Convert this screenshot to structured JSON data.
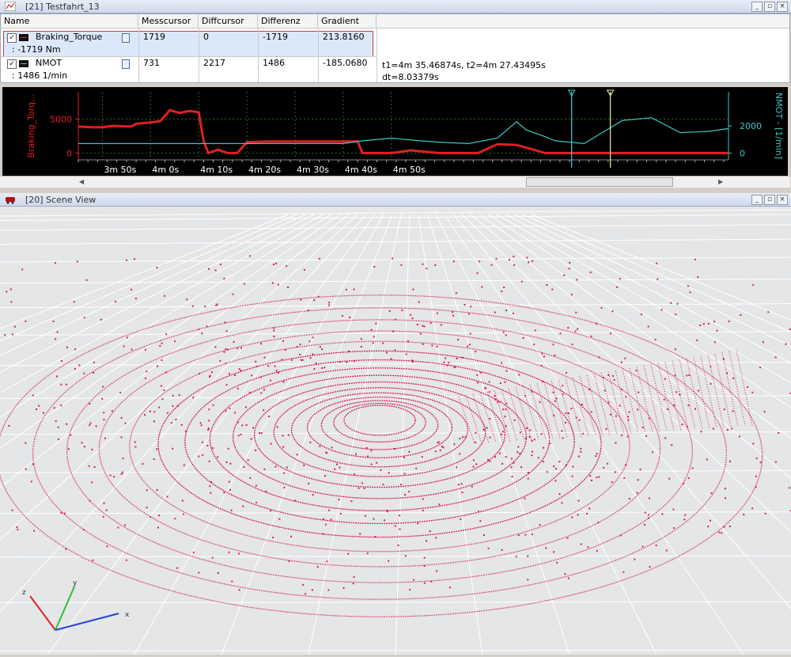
{
  "measurement_window": {
    "title": "[21] Testfahrt_13",
    "columns": [
      "Name",
      "Messcursor",
      "Diffcursor",
      "Differenz",
      "Gradient"
    ],
    "rows": [
      {
        "checked": true,
        "name": "Braking_Torque",
        "value_line": ": -1719 Nm",
        "messcursor": "1719",
        "diffcursor": "0",
        "differenz": "-1719",
        "gradient": "213.8160",
        "selected": true
      },
      {
        "checked": true,
        "name": "NMOT",
        "value_line": ": 1486 1/min",
        "messcursor": "731",
        "diffcursor": "2217",
        "differenz": "1486",
        "gradient": "-185.0680",
        "selected": false
      }
    ],
    "cursor_info": {
      "line1": "t1=4m 35.46874s, t2=4m 27.43495s",
      "line2": "dt=8.03379s"
    },
    "buttons": {
      "minimize": "_",
      "restore": "▫",
      "close": "×"
    }
  },
  "chart_data": {
    "type": "line",
    "x_unit": "s",
    "xlim": [
      165,
      300
    ],
    "x_ticks": [
      170,
      180,
      190,
      200,
      210,
      220,
      230
    ],
    "x_tick_labels": [
      "3m 50s",
      "4m 0s",
      "4m 10s",
      "4m 20s",
      "4m 30s",
      "4m 40s",
      "4m 50s"
    ],
    "left_axis": {
      "label": "Braking_Torq...",
      "ticks": [
        0,
        5000
      ],
      "ylim": [
        -1000,
        9000
      ],
      "color": "#e02020"
    },
    "right_axis": {
      "label": "NMOT - [1/min]",
      "ticks": [
        0,
        2000
      ],
      "ylim": [
        -500,
        4500
      ],
      "color": "#3cc8c8"
    },
    "cursors": [
      {
        "t": 275.47,
        "color": "#f0f0a0"
      },
      {
        "t": 267.43,
        "color": "#40d0d0"
      }
    ],
    "series": [
      {
        "name": "Braking_Torque",
        "axis": "left",
        "color": "#e02020",
        "x": [
          165,
          168,
          170,
          172,
          176,
          177,
          180,
          182,
          184,
          186,
          188,
          190,
          191,
          192,
          194,
          196,
          198,
          200,
          204,
          210,
          216,
          220,
          223,
          224,
          226,
          230,
          234,
          240,
          248,
          252,
          256,
          262,
          264,
          266,
          268,
          270,
          274,
          280,
          290,
          300
        ],
        "y": [
          3900,
          3800,
          3800,
          4000,
          3900,
          4300,
          4500,
          4700,
          6300,
          5900,
          6200,
          6000,
          1800,
          0,
          500,
          0,
          0,
          1600,
          1700,
          1700,
          1700,
          1700,
          1700,
          0,
          0,
          0,
          400,
          0,
          0,
          1300,
          1200,
          0,
          0,
          0,
          0,
          0,
          0,
          0,
          0,
          0
        ]
      },
      {
        "name": "NMOT",
        "axis": "right",
        "color": "#3cc8c8",
        "x": [
          165,
          190,
          200,
          210,
          216,
          220,
          224,
          230,
          236,
          240,
          246,
          252,
          256,
          258,
          262,
          264,
          270,
          278,
          284,
          290,
          296,
          300
        ],
        "y": [
          700,
          700,
          700,
          700,
          700,
          700,
          900,
          1100,
          900,
          800,
          700,
          1100,
          2300,
          1700,
          1200,
          900,
          700,
          2400,
          2600,
          1500,
          1600,
          1800
        ]
      }
    ]
  },
  "scene_window": {
    "title": "[20] Scene View",
    "axes": {
      "x": "x",
      "y": "y",
      "z": "z"
    },
    "colors": {
      "points": "#d82050",
      "grid": "#ffffff",
      "background": "#e4e6e8"
    }
  }
}
